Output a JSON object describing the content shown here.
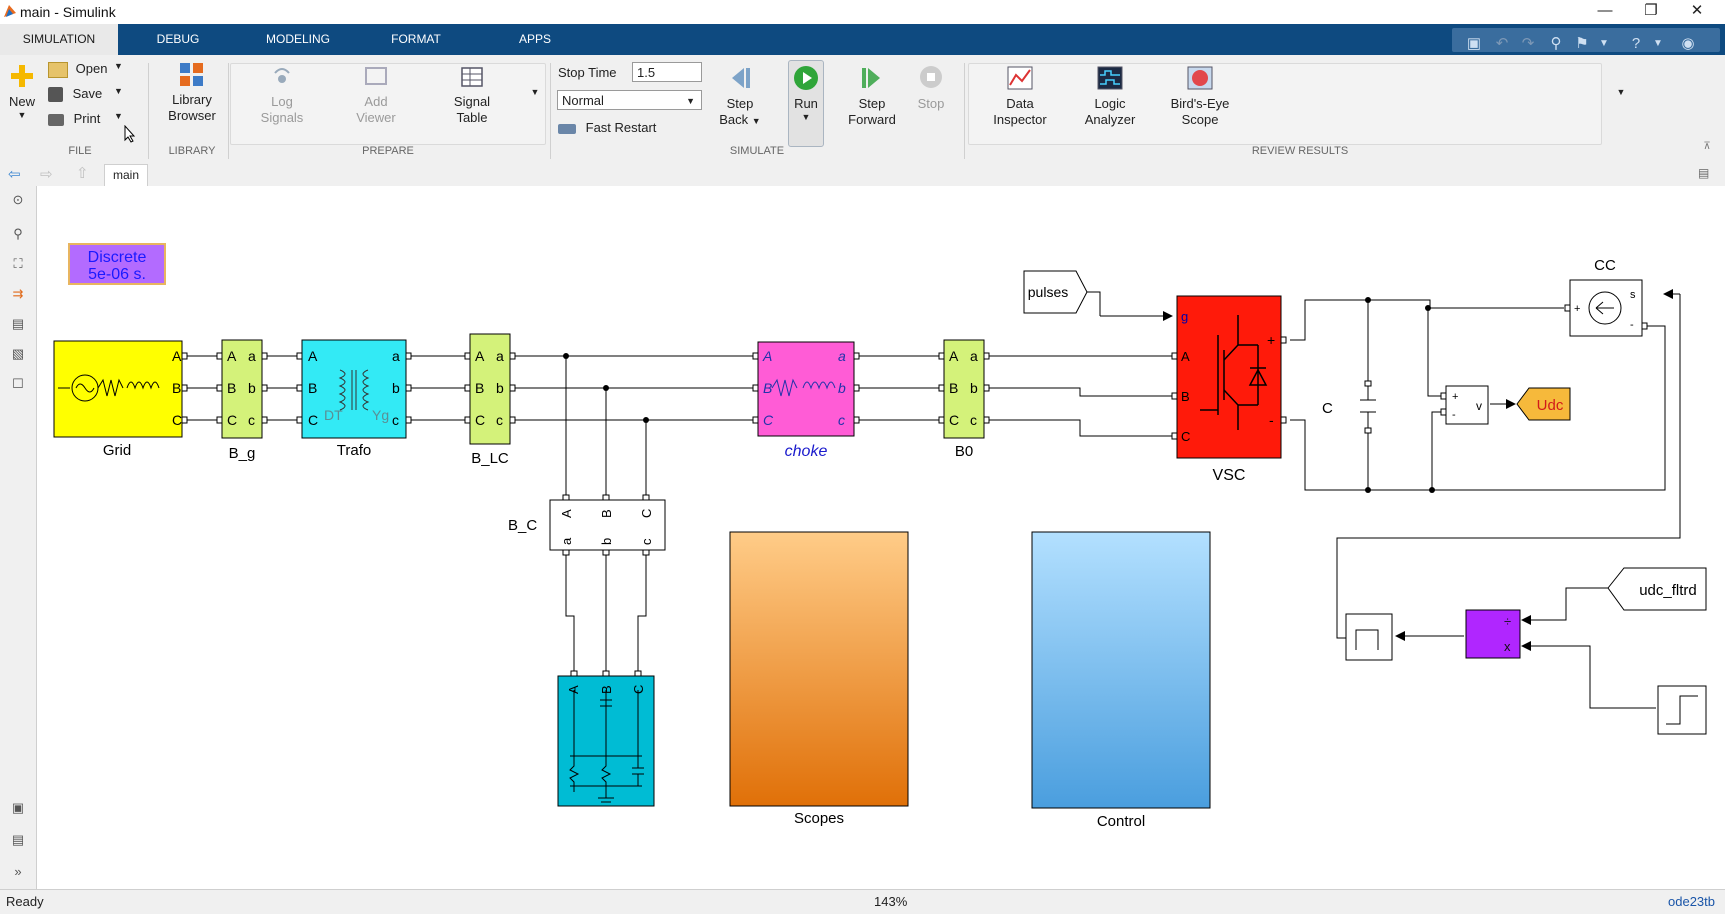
{
  "window": {
    "title": "main - Simulink",
    "minimize": "—",
    "restore": "❐",
    "close": "✕"
  },
  "tabs": [
    "SIMULATION",
    "DEBUG",
    "MODELING",
    "FORMAT",
    "APPS"
  ],
  "ribbon": {
    "file": {
      "new": "New",
      "open": "Open",
      "save": "Save",
      "print": "Print",
      "section": "FILE"
    },
    "library": {
      "browser_l1": "Library",
      "browser_l2": "Browser",
      "section": "LIBRARY"
    },
    "prepare": {
      "log_l1": "Log",
      "log_l2": "Signals",
      "viewer_l1": "Add",
      "viewer_l2": "Viewer",
      "signal_l1": "Signal",
      "signal_l2": "Table",
      "section": "PREPARE"
    },
    "simulate": {
      "stop_time_label": "Stop Time",
      "stop_time_value": "1.5",
      "mode": "Normal",
      "fast_restart": "Fast Restart",
      "step_back_l1": "Step",
      "step_back_l2": "Back",
      "run": "Run",
      "step_fwd_l1": "Step",
      "step_fwd_l2": "Forward",
      "stop": "Stop",
      "section": "SIMULATE"
    },
    "review": {
      "data_l1": "Data",
      "data_l2": "Inspector",
      "logic_l1": "Logic",
      "logic_l2": "Analyzer",
      "bird_l1": "Bird's-Eye",
      "bird_l2": "Scope",
      "section": "REVIEW RESULTS"
    }
  },
  "breadcrumb": {
    "tab": "main"
  },
  "diagram": {
    "solver_l1": "Discrete",
    "solver_l2": "5e-06 s.",
    "blocks": {
      "grid": "Grid",
      "b_g": "B_g",
      "trafo": "Trafo",
      "trafo_dt": "DT",
      "trafo_yg": "Yg",
      "b_lc": "B_LC",
      "choke": "choke",
      "b0": "B0",
      "vsc": "VSC",
      "pulses": "pulses",
      "cap": "C",
      "cc": "CC",
      "udc": "Udc",
      "b_c": "B_C",
      "scopes": "Scopes",
      "control": "Control",
      "udc_fltrd": "udc_fltrd"
    },
    "port_letters": {
      "A": "A",
      "B": "B",
      "C": "C",
      "a": "a",
      "b": "b",
      "c": "c",
      "g": "g",
      "plus": "+",
      "minus": "-",
      "v": "v",
      "s": "s",
      "x": "x",
      "mul": "÷"
    }
  },
  "status": {
    "left": "Ready",
    "zoom": "143%",
    "solver": "ode23tb"
  },
  "colors": {
    "tabbar": "#0e4a80",
    "grid_block": "#ffff00",
    "bus_block": "#d4f27a",
    "trafo_block": "#33eaf5",
    "choke_block": "#ff5cd6",
    "vsc_block": "#ff1a0a",
    "filter_block": "#00bcd4",
    "product_block": "#b026ff",
    "solver_block": "#b36bff",
    "udc_goto": "#f6b93b"
  }
}
